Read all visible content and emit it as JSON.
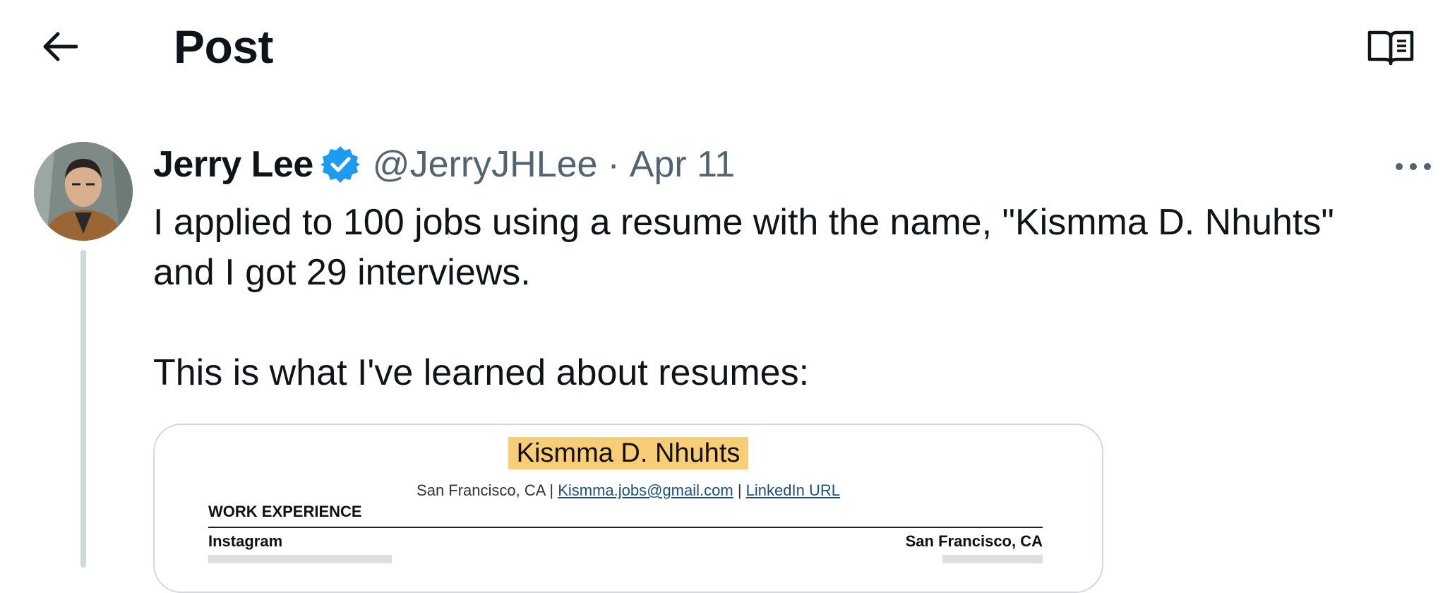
{
  "header": {
    "title": "Post",
    "back_icon": "arrow-left-icon",
    "reader_icon": "book-open-icon"
  },
  "post": {
    "author_name": "Jerry Lee",
    "handle": "@JerryJHLee",
    "separator": "·",
    "date": "Apr 11",
    "verified_color": "#1d9bf0",
    "body": "I applied to 100 jobs using a resume with the name, \"Kismma D. Nhuhts\"\nand I got 29 interviews.\n\nThis is what I've learned about resumes:",
    "more_icon": "more-horizontal-icon"
  },
  "media": {
    "resume_name": "Kismma D. Nhuhts",
    "contact_location": "San Francisco, CA",
    "contact_divider": "|",
    "contact_email": "Kismma.jobs@gmail.com",
    "contact_linkedin": "LinkedIn URL",
    "section_title": "WORK EXPERIENCE",
    "company": "Instagram",
    "company_location": "San Francisco, CA",
    "highlight_color": "#f9cd78"
  }
}
